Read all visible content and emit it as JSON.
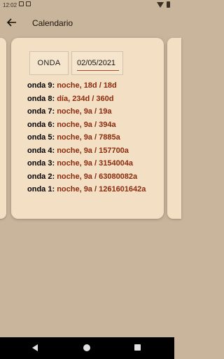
{
  "status_bar": {
    "time": "12:02",
    "notifications": [
      "ad",
      "google"
    ]
  },
  "app_bar": {
    "title": "Calendario",
    "back_icon": "arrow-left-icon"
  },
  "card": {
    "onda_label": "ONDA",
    "date_value": "02/05/2021",
    "waves": [
      {
        "label": "onda 9:",
        "value": "noche, 18d / 18d"
      },
      {
        "label": "onda 8:",
        "value": "día, 234d / 360d"
      },
      {
        "label": "onda 7:",
        "value": "noche, 9a / 19a"
      },
      {
        "label": "onda 6:",
        "value": "noche, 9a / 394a"
      },
      {
        "label": "onda 5:",
        "value": "noche, 9a / 7885a"
      },
      {
        "label": "onda 4:",
        "value": "noche, 9a / 157700a"
      },
      {
        "label": "onda 3:",
        "value": "noche, 9a / 3154004a"
      },
      {
        "label": "onda 2:",
        "value": "noche, 9a / 63080082a"
      },
      {
        "label": "onda 1:",
        "value": "noche, 9a / 1261601642a"
      }
    ]
  },
  "colors": {
    "background": "#c9b59c",
    "card": "#f3dfc4",
    "accent": "#8b2a0c"
  }
}
